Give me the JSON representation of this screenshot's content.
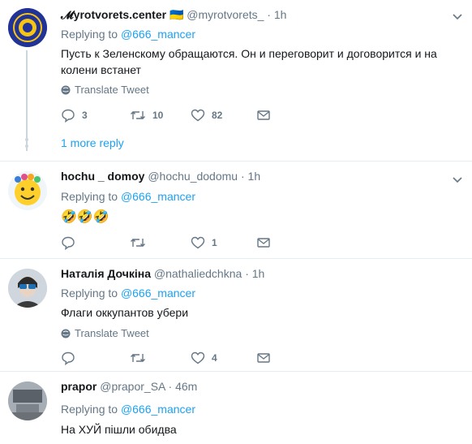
{
  "tweets": [
    {
      "name": "𝓜yrotvorets.center",
      "flag": "🇺🇦",
      "handle": "@myrotvorets_",
      "dot": "·",
      "time": "1h",
      "replying_label": "Replying to",
      "replying_to": "@666_mancer",
      "text": "Пусть к Зеленскому обращаются. Он и переговорит и договорится и на колени встанет",
      "translate": "Translate Tweet",
      "replies": "3",
      "retweets": "10",
      "likes": "82",
      "more_replies": "1 more reply"
    },
    {
      "name": "hochu _ domoy",
      "handle": "@hochu_dodomu",
      "dot": "·",
      "time": "1h",
      "replying_label": "Replying to",
      "replying_to": "@666_mancer",
      "text": "🤣🤣🤣",
      "likes": "1"
    },
    {
      "name": "Наталія Дочкіна",
      "handle": "@nathaliedchkna",
      "dot": "·",
      "time": "1h",
      "replying_label": "Replying to",
      "replying_to": "@666_mancer",
      "text": "Флаги оккупантов убери",
      "translate": "Translate Tweet",
      "likes": "4"
    },
    {
      "name": "prapor",
      "handle": "@prapor_SA",
      "dot": "·",
      "time": "46m",
      "replying_label": "Replying to",
      "replying_to": "@666_mancer",
      "text": "На ХУЙ пішли обидва"
    }
  ],
  "colors": {
    "accent": "#1da1f2",
    "muted": "#657786",
    "divider": "#e6ecf0"
  }
}
